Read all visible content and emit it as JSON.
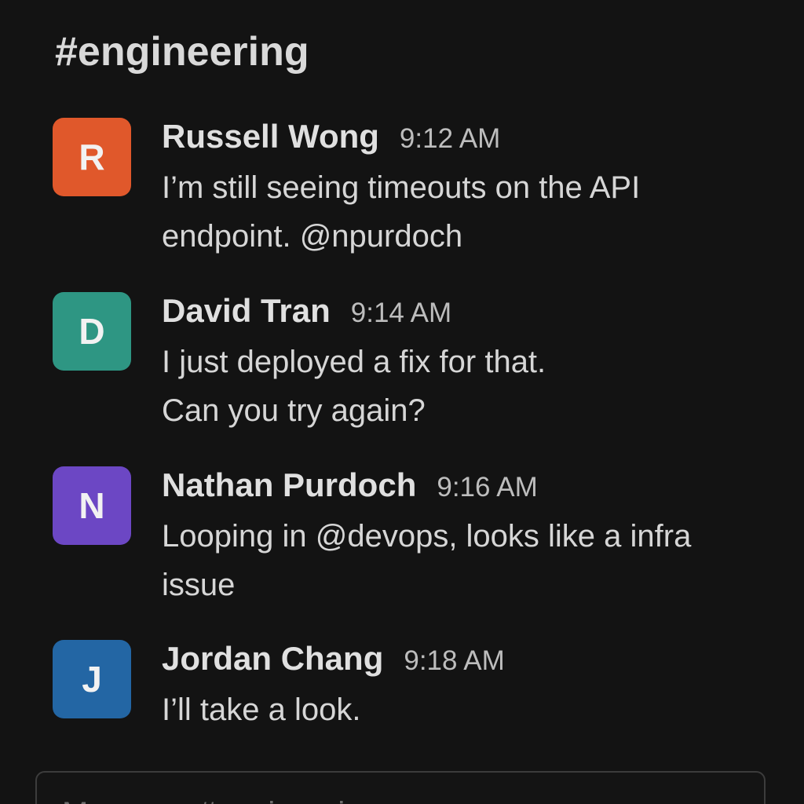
{
  "channel": {
    "hash": "#",
    "name": "engineering"
  },
  "messages": [
    {
      "initial": "R",
      "avatar_color": "#e0582b",
      "author": "Russell Wong",
      "time": "9:12 AM",
      "lines": [
        "I’m still seeing timeouts on the API",
        "endpoint. @npurdoch"
      ]
    },
    {
      "initial": "D",
      "avatar_color": "#2e9683",
      "author": "David Tran",
      "time": "9:14 AM",
      "lines": [
        "I just deployed a fix for that.",
        "Can you try again?"
      ]
    },
    {
      "initial": "N",
      "avatar_color": "#6c47c4",
      "author": "Nathan Purdoch",
      "time": "9:16 AM",
      "lines": [
        "Looping in @devops, looks like a infra",
        "issue"
      ]
    },
    {
      "initial": "J",
      "avatar_color": "#2366a4",
      "author": "Jordan Chang",
      "time": "9:18 AM",
      "lines": [
        "I’ll take a look."
      ]
    }
  ],
  "composer": {
    "placeholder": "Message #engineering"
  }
}
